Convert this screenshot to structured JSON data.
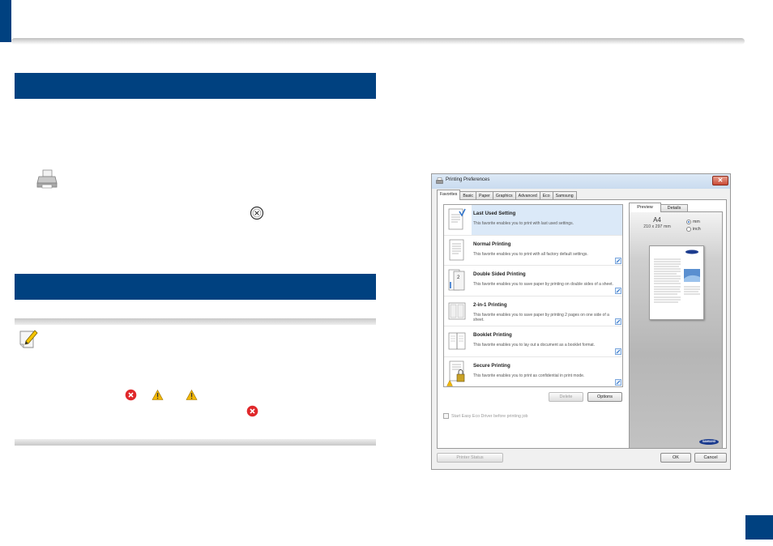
{
  "dialog": {
    "title": "Printing Preferences",
    "close_label": "✕",
    "tabs": [
      {
        "label": "Favorites"
      },
      {
        "label": "Basic"
      },
      {
        "label": "Paper"
      },
      {
        "label": "Graphics"
      },
      {
        "label": "Advanced"
      },
      {
        "label": "Eco"
      },
      {
        "label": "Samsung"
      }
    ],
    "favorites": [
      {
        "name": "Last Used Setting",
        "desc": "This favorite enables you to print with last used settings."
      },
      {
        "name": "Normal Printing",
        "desc": "This favorite enables you to print with all factory default settings."
      },
      {
        "name": "Double Sided Printing",
        "desc": "This favorite enables you to save paper by printing on double sides of a sheet."
      },
      {
        "name": "2-in-1 Printing",
        "desc": "This favorite enables you to save paper by printing 2 pages on one side of a sheet."
      },
      {
        "name": "Booklet Printing",
        "desc": "This favorite enables you to lay out a document as a booklet format."
      },
      {
        "name": "Secure Printing",
        "desc": "This favorite enables you to print as confidential in print mode."
      }
    ],
    "delete_label": "Delete",
    "options_label": "Options",
    "eco_checkbox_label": "Start Easy Eco Driver before printing job",
    "preview_tab": "Preview",
    "details_tab": "Details",
    "paper_name": "A4",
    "paper_dims": "210 x 297 mm",
    "unit_mm": "mm",
    "unit_inch": "inch",
    "unit_selected": "mm",
    "brand": "SAMSUNG",
    "printer_status_label": "Printer Status",
    "ok_label": "OK",
    "cancel_label": "Cancel"
  },
  "colors": {
    "accent_blue": "#004180",
    "error_red": "#e0282b",
    "warning_yellow": "#f2b705"
  }
}
